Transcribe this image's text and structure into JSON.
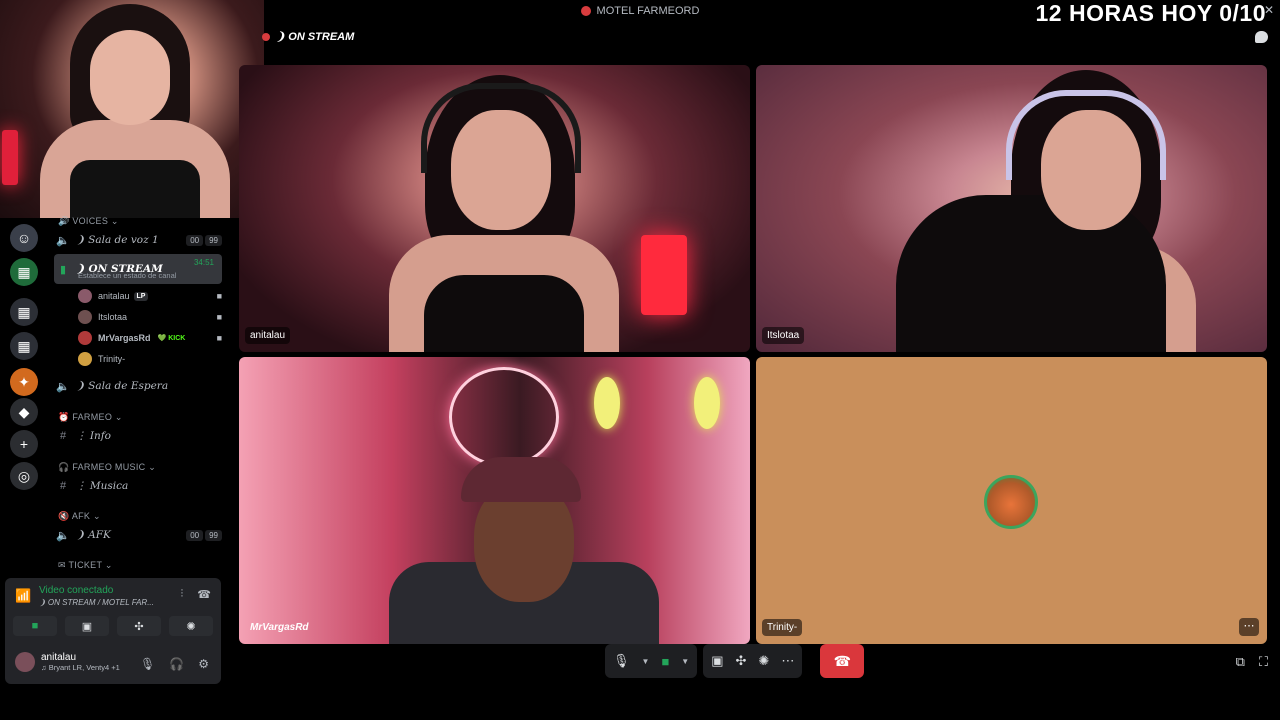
{
  "window": {
    "server_title": "MOTEL FARMEORD",
    "overlay_text": "12 HORAS HOY 0/10"
  },
  "stage": {
    "channel_title": "❩ ON STREAM"
  },
  "channels": {
    "voices_category": "VOICES",
    "sala_voz": "❩ Sala de voz 1",
    "sala_voz_counts": [
      "00",
      "99"
    ],
    "on_stream": "❩ ON STREAM",
    "on_stream_timer": "34:51",
    "on_stream_status": "Establece un estado de canal",
    "users": [
      {
        "name": "anitalau",
        "tag": "LP"
      },
      {
        "name": "Itslotaa",
        "tag": ""
      },
      {
        "name": "MrVargasRd",
        "tag": "KICK"
      },
      {
        "name": "Trinity-",
        "tag": ""
      }
    ],
    "sala_espera": "❩ Sala de Espera",
    "farmeo_category": "FARMEO",
    "info": "⋮ Info",
    "farmeo_music_category": "FARMEO MUSIC",
    "musica": "⋮ Musica",
    "afk_category": "AFK",
    "afk": "❩ AFK",
    "afk_counts": [
      "00",
      "99"
    ],
    "ticket_category": "TICKET"
  },
  "voice_panel": {
    "status": "Video conectado",
    "location": "❩ ON STREAM / MOTEL FAR...",
    "username": "anitalau",
    "activity": "Bryant LR, Venty4 +1"
  },
  "tiles": [
    {
      "label": "anitalau"
    },
    {
      "label": "Itslotaa"
    },
    {
      "label": "MrVargasRd"
    },
    {
      "label": "Trinity-"
    }
  ],
  "colors": {
    "green": "#23a55a",
    "red": "#da373c",
    "panel": "#232428"
  }
}
